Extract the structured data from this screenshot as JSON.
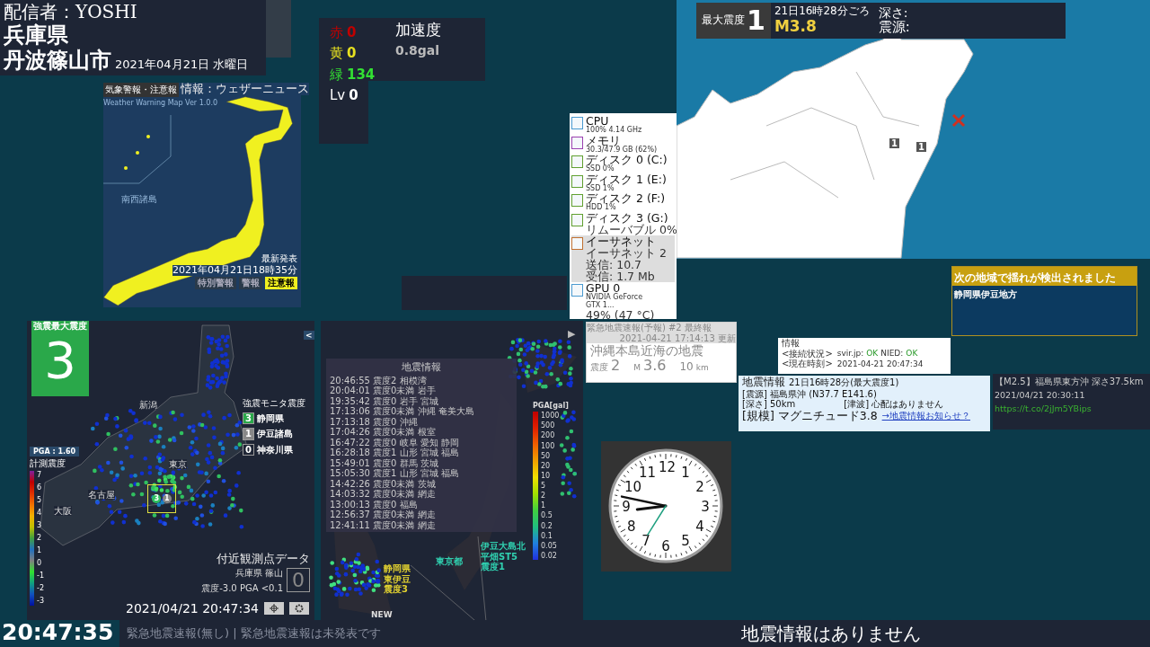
{
  "header": {
    "streamer": "配信者：YOSHI",
    "prefecture": "兵庫県",
    "city": "丹波篠山市",
    "date": "2021年04月21日 水曜日"
  },
  "counters": [
    {
      "label": "赤",
      "value": "0",
      "color": "#c00000"
    },
    {
      "label": "黄",
      "value": "0",
      "color": "#e6e020"
    },
    {
      "label": "緑",
      "value": "134",
      "color": "#33e033"
    },
    {
      "label": "Lv",
      "value": "0",
      "color": "#ffffff"
    }
  ],
  "acceleration": {
    "title": "加速度",
    "value": "0.8gal"
  },
  "weather_map": {
    "title": "気象警報・注意報",
    "subtitle": "Weather Warning Map  Ver 1.0.0",
    "source": "情報：ウェザーニュース",
    "inset_label": "南西諸島",
    "latest_label": "最新発表",
    "issued": "2021年04月21日18時35分",
    "legend": [
      {
        "label": "特別警報",
        "selected": false
      },
      {
        "label": "警報",
        "selected": false
      },
      {
        "label": "注意報",
        "selected": true
      }
    ]
  },
  "task_manager": {
    "items": [
      {
        "name": "CPU",
        "details": [
          "100% 4.14 GHz"
        ],
        "color": "#4a9ad0",
        "selected": false
      },
      {
        "name": "メモリ",
        "details": [
          "30.3/47.9 GB (62%)"
        ],
        "color": "#9a40b0",
        "selected": false
      },
      {
        "name": "ディスク 0 (C:)",
        "details": [
          "SSD 0%"
        ],
        "color": "#60a030",
        "selected": false
      },
      {
        "name": "ディスク 1 (E:)",
        "details": [
          "SSD 1%"
        ],
        "color": "#60a030",
        "selected": false
      },
      {
        "name": "ディスク 2 (F:)",
        "details": [
          "HDD 1%"
        ],
        "color": "#60a030",
        "selected": false
      },
      {
        "name": "ディスク 3 (G:)",
        "details": [
          "リムーバブル 0%"
        ],
        "color": "#60a030",
        "selected": false
      },
      {
        "name": "イーサネット",
        "details": [
          "イーサネット 2",
          "送信: 10.7",
          "受信: 1.7 Mb"
        ],
        "color": "#c07030",
        "selected": true
      },
      {
        "name": "GPU 0",
        "details": [
          "NVIDIA GeForce",
          "GTX 1...",
          "49% (47 °C)"
        ],
        "color": "#4a9ad0",
        "selected": false
      }
    ]
  },
  "quake_map": {
    "max_label": "最大震度",
    "max_value": "1",
    "time": "21日16時28分ごろ",
    "magnitude": "M3.8",
    "depth_label": "深さ:",
    "epicenter_label": "震源:",
    "markers": [
      "1",
      "1"
    ]
  },
  "eew": {
    "header": "緊急地震速報(予報)  #2 最終報",
    "updated": "2021-04-21 17:14:13 更新",
    "title": "沖縄本島近海の地震",
    "intensity_label": "震度",
    "intensity": "2",
    "magnitude_label": "M",
    "magnitude": "3.6",
    "depth": "10",
    "depth_unit": "km"
  },
  "detection": {
    "title": "次の地域で揺れが検出されました",
    "regions": [
      "静岡県伊豆地方"
    ]
  },
  "status": {
    "heading": "情報",
    "rows": [
      {
        "label": "<接続状況>",
        "parts": [
          {
            "text": "svir.jp:",
            "ok": false
          },
          {
            "text": "OK",
            "ok": true
          },
          {
            "text": "NIED:",
            "ok": false
          },
          {
            "text": "OK",
            "ok": true
          }
        ]
      },
      {
        "label": "<現在時刻>",
        "parts": [
          {
            "text": "2021-04-21 20:47:34",
            "ok": false
          }
        ]
      }
    ]
  },
  "quake_info": {
    "title": "地震情報",
    "subtitle": "21日16時28分(最大震度1)",
    "epicenter": "[震源] 福島県沖 (N37.7 E141.6)",
    "depth": "[深さ] 50km",
    "tsunami": "[津波] 心配はありません",
    "scale": "[規模] マグニチュード3.8",
    "link": "→地震情報お知らせ？"
  },
  "tweet": {
    "headline": "【M2.5】福島県東方沖 深さ37.5km",
    "time": "2021/04/21 20:30:11",
    "url": "https://t.co/2jJm5YBips"
  },
  "kyoshin": {
    "max_label": "強震最大震度",
    "max_value": "3",
    "collapse": "<",
    "pga": "PGA : 1.60",
    "scale_title": "計測震度",
    "scale": [
      "7",
      "6",
      "5",
      "4",
      "3",
      "2",
      "1",
      "0",
      "-1",
      "-2",
      "-3"
    ],
    "cities": [
      "新潟",
      "東京",
      "名古屋",
      "大阪"
    ],
    "box_markers": [
      "3",
      "1"
    ],
    "legend_title": "強震モニタ震度",
    "legend": [
      {
        "intensity": "3",
        "name": "静岡県",
        "color": "#2aa84a"
      },
      {
        "intensity": "1",
        "name": "伊豆諸島",
        "color": "#888888"
      },
      {
        "intensity": "0",
        "name": "神奈川県",
        "color": "#1e2535"
      }
    ],
    "nearby_title": "付近観測点データ",
    "nearby_station": "兵庫県 篠山",
    "nearby_reading": "震度-3.0  PGA <0.1",
    "nearby_value": "0",
    "timestamp": "2021/04/21 20:47:34"
  },
  "seismic": {
    "title": "地震情報",
    "entries": [
      "20:46:55 震度2 相模湾",
      "20:04:01 震度0未満 岩手",
      "19:35:42 震度0 岩手 宮城",
      "17:13:06 震度0未満 沖縄 奄美大島",
      "17:13:18 震度0 沖縄",
      "17:04:26 震度0未満 根室",
      "16:47:22 震度0 岐阜 愛知 静岡",
      "16:28:18 震度1 山形 宮城 福島",
      "15:49:01 震度0 群馬 茨城",
      "15:05:30 震度1 山形 宮城 福島",
      "14:42:26 震度0未満 茨城",
      "14:03:32 震度0未満 網走",
      "13:00:13 震度0 福島",
      "12:56:37 震度0未満 網走",
      "12:41:11 震度0未満 網走"
    ],
    "pga_title": "PGA[gal]",
    "pga_ticks": [
      "1000",
      "500",
      "200",
      "100",
      "50",
      "20",
      "10",
      "5",
      "2",
      "1",
      "0.5",
      "0.2",
      "0.1",
      "0.05",
      "0.02"
    ],
    "callouts": [
      {
        "lines": [
          "静岡県",
          "東伊豆",
          "震度3"
        ],
        "kind": "yellow"
      },
      {
        "lines": [
          "伊豆大島北",
          "平畑ST5",
          "震度1"
        ],
        "kind": "teal"
      },
      {
        "lines": [
          "東京都"
        ],
        "kind": "teal"
      }
    ],
    "new_label": "NEW",
    "play": "▶"
  },
  "clock": {
    "numerals": [
      "11",
      "12",
      "1",
      "10",
      "2",
      "9",
      "3",
      "8",
      "4",
      "7",
      "5",
      "6"
    ]
  },
  "digital_clock": "20:47:35",
  "ticker": "緊急地震速報(無し) |  緊急地震速報は未発表です",
  "bottom_message": "地震情報はありません"
}
